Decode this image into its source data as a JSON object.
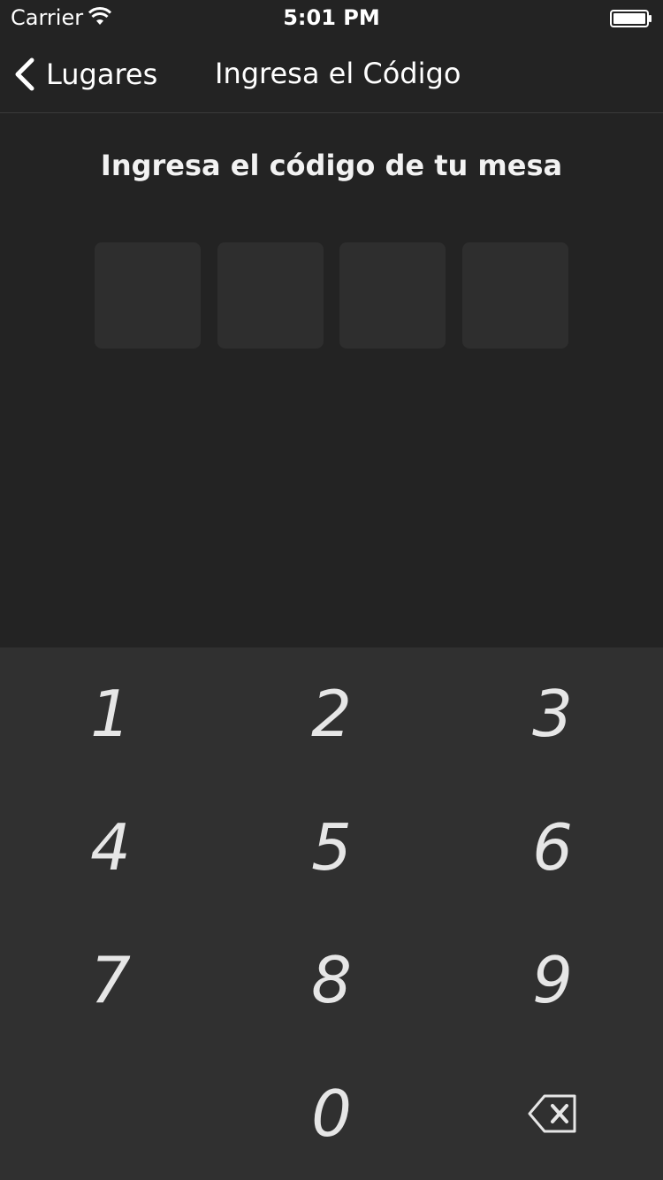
{
  "status_bar": {
    "carrier": "Carrier",
    "time": "5:01 PM",
    "icons": {
      "wifi": "wifi-icon",
      "battery": "battery-icon"
    }
  },
  "nav": {
    "back_label": "Lugares",
    "title": "Ingresa el Código",
    "back_icon": "chevron-left-icon"
  },
  "instruction": "Ingresa el código de tu mesa",
  "code": {
    "digits": [
      "",
      "",
      "",
      ""
    ]
  },
  "keypad": {
    "keys": [
      "1",
      "2",
      "3",
      "4",
      "5",
      "6",
      "7",
      "8",
      "9",
      "",
      "0",
      ""
    ],
    "delete_icon": "backspace-icon"
  },
  "colors": {
    "background": "#232323",
    "keypad_background": "#303030",
    "code_box": "#2e2e2e",
    "text": "#ffffff",
    "key_text": "#e6e6e6"
  }
}
